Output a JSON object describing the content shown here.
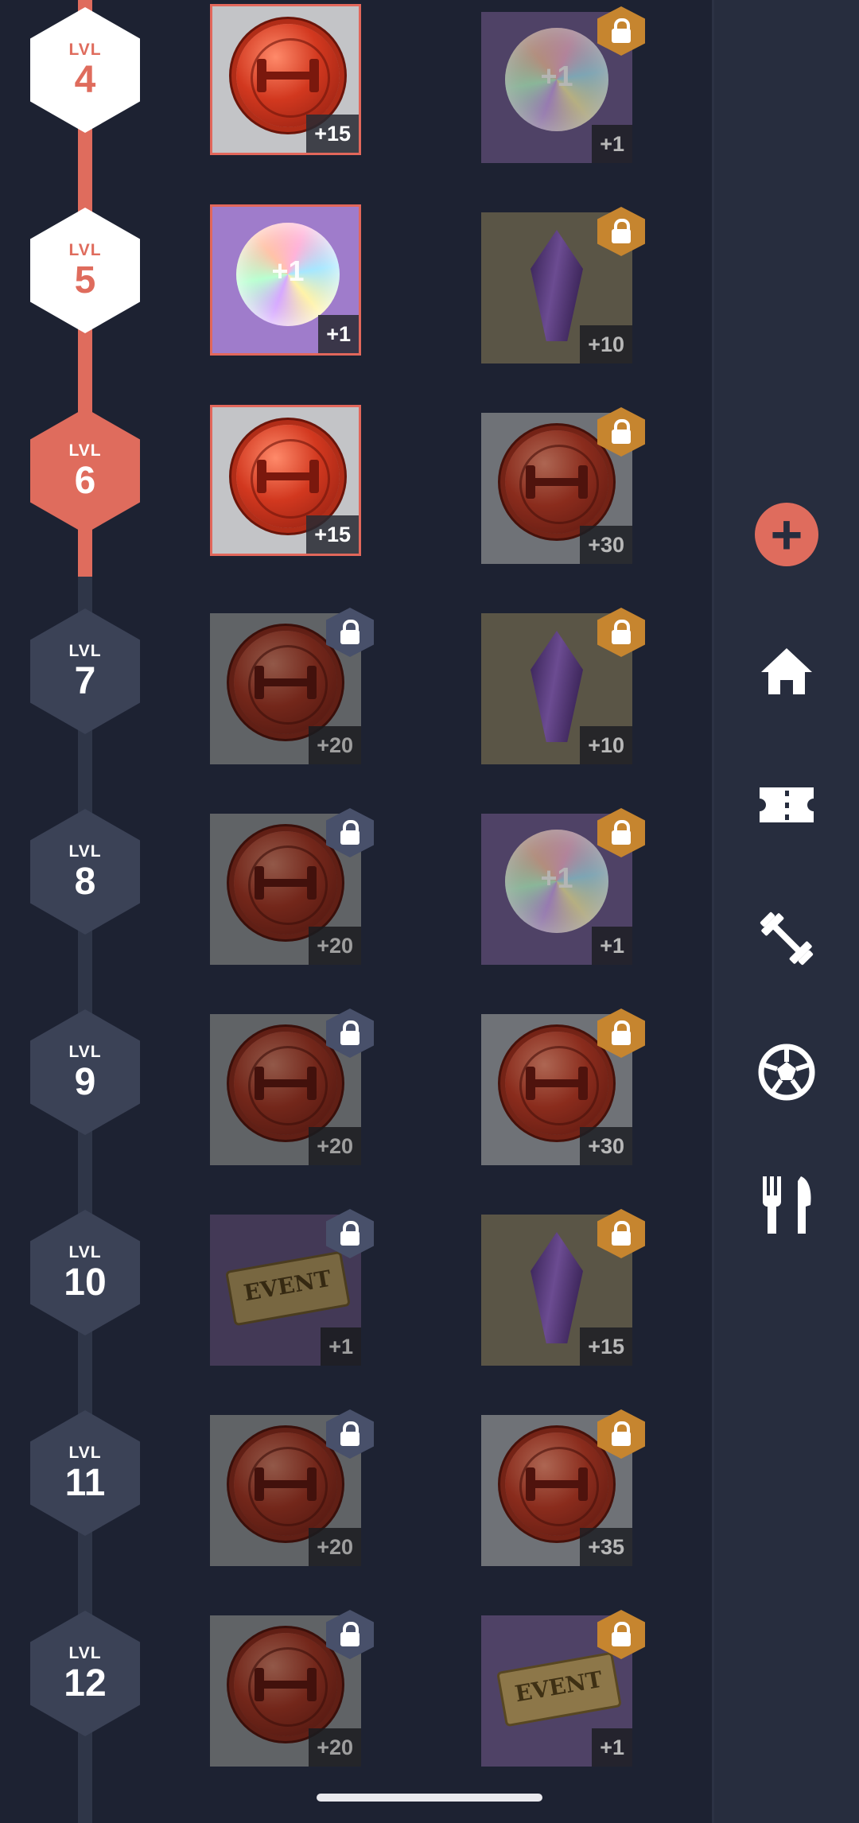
{
  "level_prefix": "LVL",
  "current_level": 6,
  "levels": [
    {
      "level": "4",
      "status": "done",
      "free": {
        "item": "coin",
        "amount": "+15",
        "state": "claimed"
      },
      "premium": {
        "item": "orb",
        "amount": "+1",
        "state": "locked"
      }
    },
    {
      "level": "5",
      "status": "done",
      "free": {
        "item": "orb",
        "amount": "+1",
        "state": "claimed"
      },
      "premium": {
        "item": "crystal",
        "amount": "+10",
        "state": "locked"
      }
    },
    {
      "level": "6",
      "status": "current",
      "free": {
        "item": "coin",
        "amount": "+15",
        "state": "claimed"
      },
      "premium": {
        "item": "coin",
        "amount": "+30",
        "state": "locked"
      }
    },
    {
      "level": "7",
      "status": "locked",
      "free": {
        "item": "coin",
        "amount": "+20",
        "state": "locked"
      },
      "premium": {
        "item": "crystal",
        "amount": "+10",
        "state": "locked"
      }
    },
    {
      "level": "8",
      "status": "locked",
      "free": {
        "item": "coin",
        "amount": "+20",
        "state": "locked"
      },
      "premium": {
        "item": "orb",
        "amount": "+1",
        "state": "locked"
      }
    },
    {
      "level": "9",
      "status": "locked",
      "free": {
        "item": "coin",
        "amount": "+20",
        "state": "locked"
      },
      "premium": {
        "item": "coin",
        "amount": "+30",
        "state": "locked"
      }
    },
    {
      "level": "10",
      "status": "locked",
      "free": {
        "item": "ticket",
        "amount": "+1",
        "state": "locked"
      },
      "premium": {
        "item": "crystal",
        "amount": "+15",
        "state": "locked"
      }
    },
    {
      "level": "11",
      "status": "locked",
      "free": {
        "item": "coin",
        "amount": "+20",
        "state": "locked"
      },
      "premium": {
        "item": "coin",
        "amount": "+35",
        "state": "locked"
      }
    },
    {
      "level": "12",
      "status": "locked",
      "free": {
        "item": "coin",
        "amount": "+20",
        "state": "locked"
      },
      "premium": {
        "item": "ticket",
        "amount": "+1",
        "state": "locked"
      }
    }
  ],
  "orb_label": "+1",
  "ticket_label": "EVENT",
  "sidebar": {
    "items": [
      {
        "name": "plus-icon",
        "label": "+"
      },
      {
        "name": "home-icon"
      },
      {
        "name": "ticket-icon"
      },
      {
        "name": "dumbbell-icon"
      },
      {
        "name": "soccer-ball-icon"
      },
      {
        "name": "fork-knife-icon"
      }
    ]
  },
  "colors": {
    "background": "#1d2232",
    "accent": "#df6c5d",
    "premium_lock": "#c6852f",
    "free_lock": "#48506a",
    "sidebar": "#272d3e"
  }
}
